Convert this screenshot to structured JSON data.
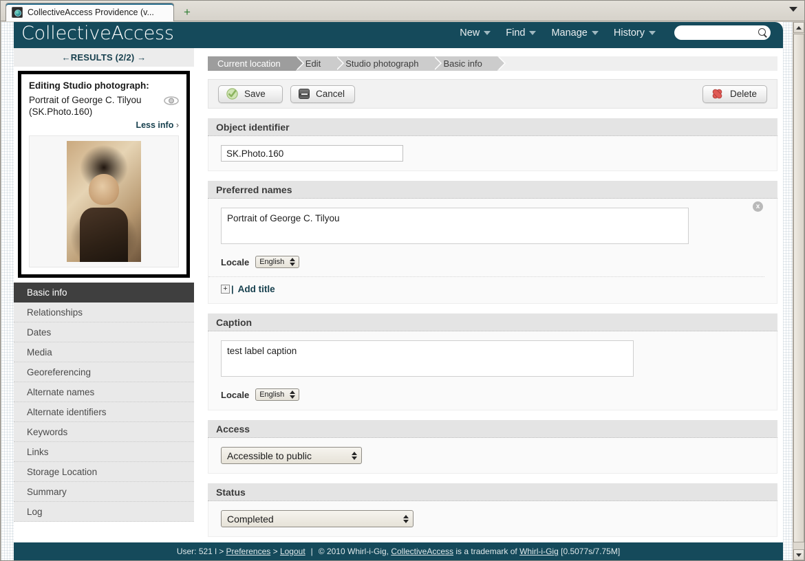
{
  "browser": {
    "tab_title": "CollectiveAccess Providence (v...",
    "new_tab_label": "+",
    "tab_list_label": "▾"
  },
  "header": {
    "logo": "CollectiveAccess",
    "nav": [
      {
        "label": "New"
      },
      {
        "label": "Find"
      },
      {
        "label": "Manage"
      },
      {
        "label": "History"
      }
    ],
    "search": {
      "value": "",
      "placeholder": ""
    }
  },
  "sidebar": {
    "results_nav": "←RESULTS (2/2) →",
    "info": {
      "title": "Editing Studio photograph:",
      "subtitle": "Portrait of George C. Tilyou (SK.Photo.160)",
      "less_info": "Less info",
      "chevron": "›"
    },
    "nav_items": [
      {
        "label": "Basic info",
        "active": true
      },
      {
        "label": "Relationships",
        "active": false
      },
      {
        "label": "Dates",
        "active": false
      },
      {
        "label": "Media",
        "active": false
      },
      {
        "label": "Georeferencing",
        "active": false
      },
      {
        "label": "Alternate names",
        "active": false
      },
      {
        "label": "Alternate identifiers",
        "active": false
      },
      {
        "label": "Keywords",
        "active": false
      },
      {
        "label": "Links",
        "active": false
      },
      {
        "label": "Storage Location",
        "active": false
      },
      {
        "label": "Summary",
        "active": false
      },
      {
        "label": "Log",
        "active": false
      }
    ]
  },
  "breadcrumb": [
    {
      "label": "Current location",
      "current": true
    },
    {
      "label": "Edit",
      "current": false
    },
    {
      "label": "Studio photograph",
      "current": false
    },
    {
      "label": "Basic info",
      "current": false
    }
  ],
  "toolbar": {
    "save_label": "Save",
    "cancel_label": "Cancel",
    "delete_label": "Delete"
  },
  "sections": {
    "object_identifier": {
      "heading": "Object identifier",
      "value": "SK.Photo.160"
    },
    "preferred_names": {
      "heading": "Preferred names",
      "value": "Portrait of George C. Tilyou",
      "locale_label": "Locale",
      "locale_value": "English",
      "remove_label": "x",
      "add_plus": "+",
      "add_pipe": "|",
      "add_label": "Add title"
    },
    "caption": {
      "heading": "Caption",
      "value": "test label caption",
      "locale_label": "Locale",
      "locale_value": "English"
    },
    "access": {
      "heading": "Access",
      "value": "Accessible to public"
    },
    "status": {
      "heading": "Status",
      "value": "Completed"
    }
  },
  "footer": {
    "user": "User: 521 l >",
    "preferences": "Preferences",
    "gt": ">",
    "logout": "Logout",
    "divider": "|",
    "copyright": "© 2010 Whirl-i-Gig,",
    "product": "CollectiveAccess",
    "trademark_text": "is a trademark of",
    "company": "Whirl-i-Gig",
    "perf": "[0.5077s/7.75M]"
  },
  "colors": {
    "brand_teal": "#154a5b",
    "active_nav": "#3f3f3f",
    "link": "#17404e"
  }
}
